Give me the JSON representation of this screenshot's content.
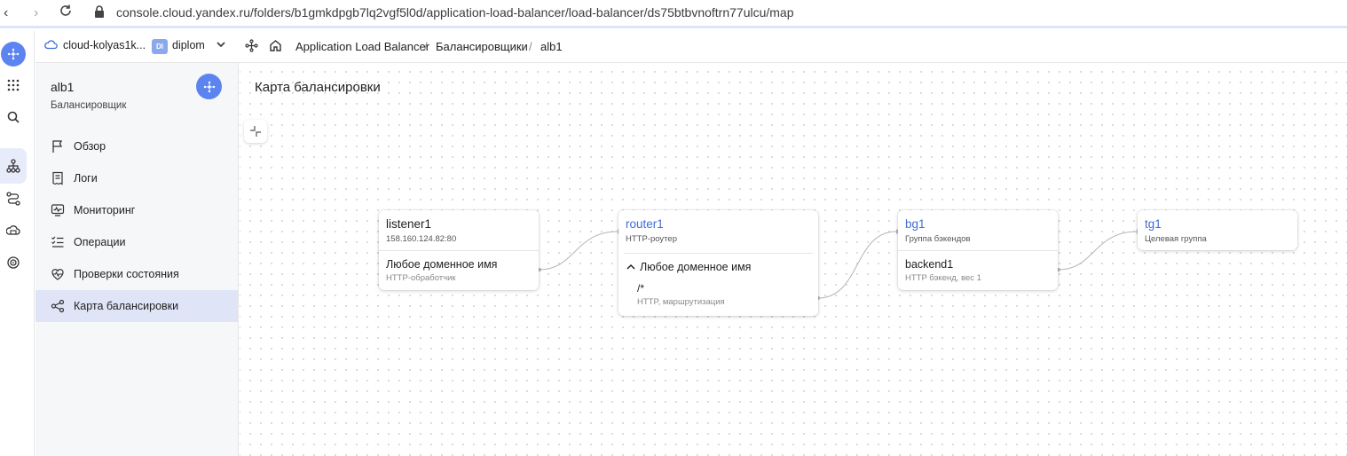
{
  "browser": {
    "url": "console.cloud.yandex.ru/folders/b1gmkdpgb7lq2vgf5l0d/application-load-balancer/load-balancer/ds75btbvnoftrn77ulcu/map"
  },
  "header": {
    "cloud_name": "cloud-kolyas1k...",
    "folder_badge": "DI",
    "folder_name": "diplom",
    "breadcrumbs": [
      "Application Load Balancer",
      "/",
      "Балансировщики",
      "/",
      "alb1"
    ]
  },
  "sidebar": {
    "title": "alb1",
    "subtitle": "Балансировщик",
    "items": [
      {
        "label": "Обзор",
        "icon": "flag-icon"
      },
      {
        "label": "Логи",
        "icon": "logs-icon"
      },
      {
        "label": "Мониторинг",
        "icon": "monitoring-icon"
      },
      {
        "label": "Операции",
        "icon": "operations-icon"
      },
      {
        "label": "Проверки состояния",
        "icon": "heartbeat-icon"
      },
      {
        "label": "Карта балансировки",
        "icon": "map-icon",
        "active": true
      }
    ]
  },
  "main": {
    "title": "Карта балансировки",
    "nodes": {
      "listener": {
        "title": "listener1",
        "subtitle": "158.160.124.82:80",
        "row_title": "Любое доменное имя",
        "row_subtitle": "HTTP-обработчик"
      },
      "router": {
        "title": "router1",
        "subtitle": "HTTP-роутер",
        "host": "Любое доменное имя",
        "route_path": "/*",
        "route_subtitle": "HTTP, маршрутизация"
      },
      "backend_group": {
        "title": "bg1",
        "subtitle": "Группа бэкендов",
        "row_title": "backend1",
        "row_subtitle": "HTTP бэкенд, вес 1"
      },
      "target_group": {
        "title": "tg1",
        "subtitle": "Целевая группа"
      }
    }
  },
  "colors": {
    "accent": "#5c84f0",
    "link": "#3f6cd8",
    "active_bg": "#dfe5f7"
  }
}
